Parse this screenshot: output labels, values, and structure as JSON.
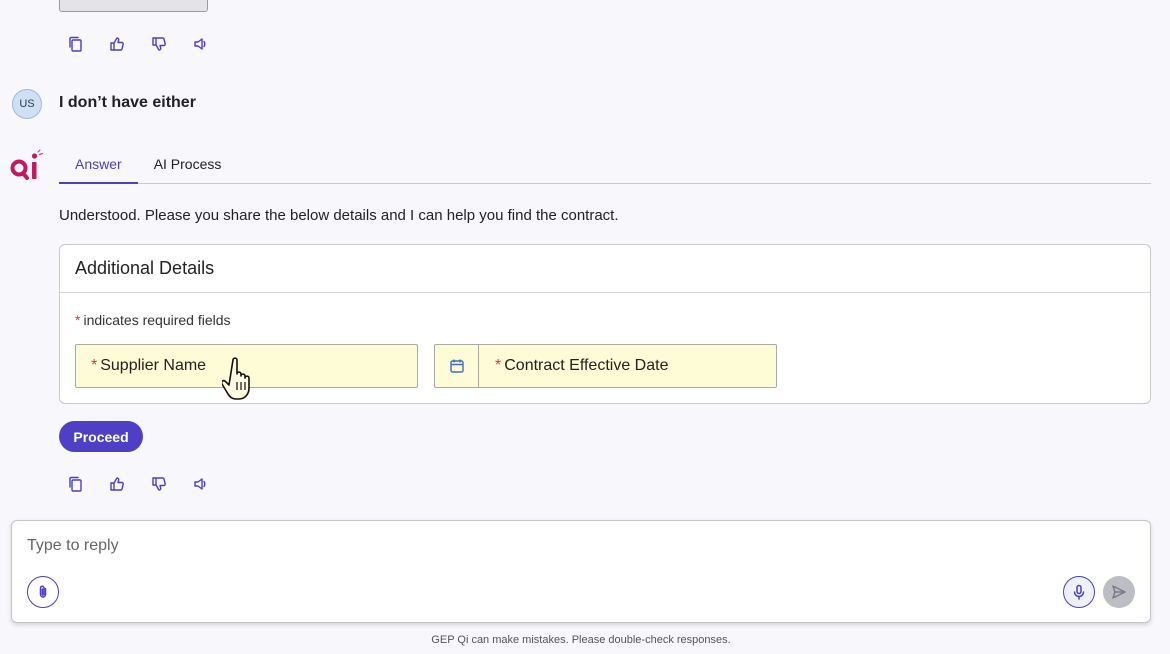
{
  "conversation": {
    "user_avatar": "US",
    "user_message": "I don’t have either",
    "tabs": [
      {
        "label": "Answer",
        "active": true
      },
      {
        "label": "AI Process",
        "active": false
      }
    ],
    "answer_text": "Understood. Please you share the below details and I can help you find the contract."
  },
  "form": {
    "title": "Additional Details",
    "required_star": "*",
    "required_note": "indicates required fields",
    "fields": [
      {
        "label": "Supplier Name",
        "required": true
      },
      {
        "label": "Contract Effective Date",
        "required": true,
        "icon": "calendar-icon"
      }
    ],
    "proceed_label": "Proceed"
  },
  "message_actions": [
    "copy-icon",
    "thumbs-up-icon",
    "thumbs-down-icon",
    "speaker-icon"
  ],
  "reply": {
    "placeholder": "Type to reply"
  },
  "disclaimer": "GEP Qi can make mistakes. Please double-check responses.",
  "colors": {
    "accent": "#4f3fc6",
    "field_bg": "#fdfcd6",
    "required": "#d23a3a",
    "logo_pink": "#c4185f"
  }
}
